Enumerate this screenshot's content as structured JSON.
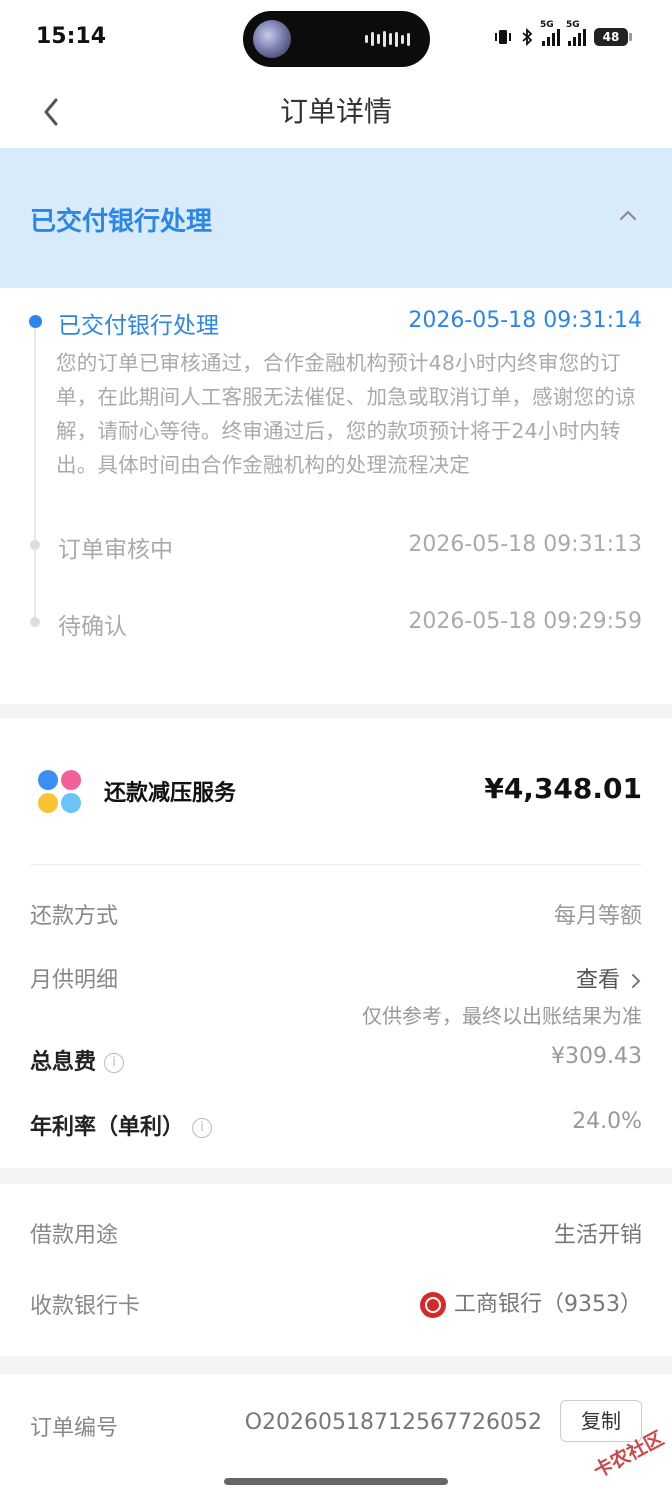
{
  "status_bar": {
    "time": "15:14",
    "battery": "48"
  },
  "nav": {
    "title": "订单详情"
  },
  "banner": {
    "title": "已交付银行处理"
  },
  "timeline": [
    {
      "label": "已交付银行处理",
      "time": "2026-05-18 09:31:14",
      "description": "您的订单已审核通过，合作金融机构预计48小时内终审您的订单，在此期间人工客服无法催促、加急或取消订单，感谢您的谅解，请耐心等待。终审通过后，您的款项预计将于24小时内转出。具体时间由合作金融机构的处理流程决定",
      "active": true
    },
    {
      "label": "订单审核中",
      "time": "2026-05-18 09:31:13",
      "active": false
    },
    {
      "label": "待确认",
      "time": "2026-05-18 09:29:59",
      "active": false
    }
  ],
  "service": {
    "name": "还款减压服务",
    "amount": "¥4,348.01",
    "repayment_method": {
      "label": "还款方式",
      "value": "每月等额"
    },
    "monthly_detail": {
      "label": "月供明细",
      "value": "查看",
      "note": "仅供参考，最终以出账结果为准"
    },
    "total_interest": {
      "label": "总息费",
      "value": "¥309.43"
    },
    "annual_rate": {
      "label": "年利率（单利）",
      "value": "24.0%"
    }
  },
  "loan": {
    "purpose": {
      "label": "借款用途",
      "value": "生活开销"
    },
    "bank_card": {
      "label": "收款银行卡",
      "value": "工商银行（9353）"
    }
  },
  "order": {
    "number_label": "订单编号",
    "number_value": "O20260518712567726052",
    "copy_label": "复制"
  },
  "watermark": "卡农社区",
  "colors": {
    "accent": "#2a86e8",
    "banner_bg": "#d8ebfb",
    "inactive": "#aaaaaa"
  }
}
